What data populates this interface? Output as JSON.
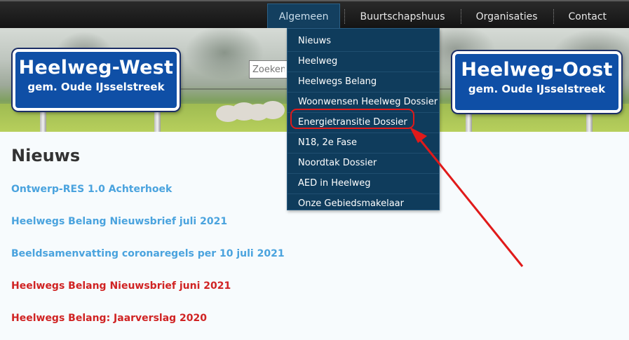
{
  "nav": {
    "items": [
      {
        "label": "Algemeen"
      },
      {
        "label": "Buurtschapshuus"
      },
      {
        "label": "Organisaties"
      },
      {
        "label": "Contact"
      }
    ]
  },
  "banner": {
    "left_sign": {
      "title": "Heelweg-West",
      "subtitle": "gem. Oude IJsselstreek"
    },
    "right_sign": {
      "title": "Heelweg-Oost",
      "subtitle": "gem. Oude IJsselstreek"
    }
  },
  "search": {
    "placeholder": "Zoeken..."
  },
  "dropdown": {
    "items": [
      {
        "label": "Nieuws"
      },
      {
        "label": "Heelweg"
      },
      {
        "label": "Heelwegs Belang"
      },
      {
        "label": "Woonwensen Heelweg Dossier"
      },
      {
        "label": "Energietransitie Dossier"
      },
      {
        "label": "N18, 2e Fase"
      },
      {
        "label": "Noordtak Dossier"
      },
      {
        "label": "AED in Heelweg"
      },
      {
        "label": "Onze Gebiedsmakelaar"
      }
    ]
  },
  "content": {
    "title": "Nieuws",
    "articles": [
      {
        "title": "Ontwerp-RES 1.0 Achterhoek"
      },
      {
        "title": "Heelwegs Belang Nieuwsbrief juli 2021"
      },
      {
        "title": "Beeldsamenvatting coronaregels per 10 juli 2021"
      },
      {
        "title": "Heelwegs Belang Nieuwsbrief juni 2021"
      },
      {
        "title": "Heelwegs Belang: Jaarverslag 2020"
      }
    ]
  },
  "colors": {
    "link_blue": "#4aa3de",
    "link_red": "#d02323",
    "dropdown_bg": "#0f3c5c",
    "highlight": "#e01a1a"
  }
}
